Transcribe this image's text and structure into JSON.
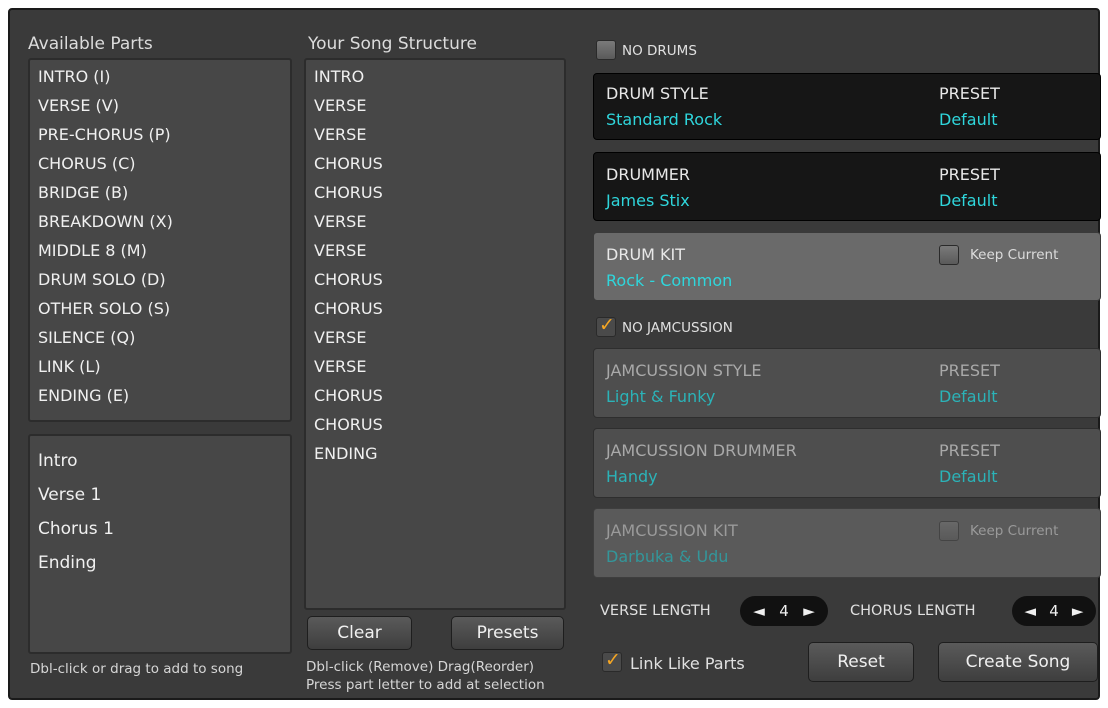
{
  "available_parts": {
    "title": "Available Parts",
    "items": [
      "INTRO (I)",
      "VERSE (V)",
      "PRE-CHORUS (P)",
      "CHORUS (C)",
      "BRIDGE (B)",
      "BREAKDOWN (X)",
      "MIDDLE 8 (M)",
      "DRUM SOLO (D)",
      "OTHER SOLO (S)",
      "SILENCE (Q)",
      "LINK (L)",
      "ENDING (E)"
    ],
    "named_parts": [
      "Intro",
      "Verse 1",
      "Chorus 1",
      "Ending"
    ],
    "hint": "Dbl-click or drag to add to song"
  },
  "song_structure": {
    "title": "Your Song Structure",
    "items": [
      "INTRO",
      "VERSE",
      "VERSE",
      "CHORUS",
      "CHORUS",
      "VERSE",
      "VERSE",
      "CHORUS",
      "CHORUS",
      "VERSE",
      "VERSE",
      "CHORUS",
      "CHORUS",
      "ENDING"
    ],
    "clear_label": "Clear",
    "presets_label": "Presets",
    "hint_line1": "Dbl-click (Remove) Drag(Reorder)",
    "hint_line2": "Press part letter to add at selection"
  },
  "drums": {
    "no_drums_label": "NO DRUMS",
    "no_drums_checked": false,
    "style_label": "DRUM STYLE",
    "style_value": "Standard Rock",
    "style_preset_label": "PRESET",
    "style_preset_value": "Default",
    "drummer_label": "DRUMMER",
    "drummer_value": "James Stix",
    "drummer_preset_label": "PRESET",
    "drummer_preset_value": "Default",
    "kit_label": "DRUM KIT",
    "kit_value": "Rock - Common",
    "keep_current_label": "Keep Current"
  },
  "jamcussion": {
    "no_jam_label": "NO JAMCUSSION",
    "no_jam_checked": true,
    "style_label": "JAMCUSSION STYLE",
    "style_value": "Light & Funky",
    "style_preset_label": "PRESET",
    "style_preset_value": "Default",
    "drummer_label": "JAMCUSSION DRUMMER",
    "drummer_value": "Handy",
    "drummer_preset_label": "PRESET",
    "drummer_preset_value": "Default",
    "kit_label": "JAMCUSSION KIT",
    "kit_value": "Darbuka & Udu",
    "keep_current_label": "Keep Current"
  },
  "lengths": {
    "verse_label": "VERSE LENGTH",
    "verse_value": "4",
    "chorus_label": "CHORUS LENGTH",
    "chorus_value": "4",
    "left_arrow": "◄",
    "right_arrow": "►"
  },
  "footer": {
    "link_like_label": "Link Like Parts",
    "link_like_checked": true,
    "reset_label": "Reset",
    "create_label": "Create Song"
  },
  "colors": {
    "accent_value": "#2fd6dc",
    "check_orange": "#f5a623"
  }
}
